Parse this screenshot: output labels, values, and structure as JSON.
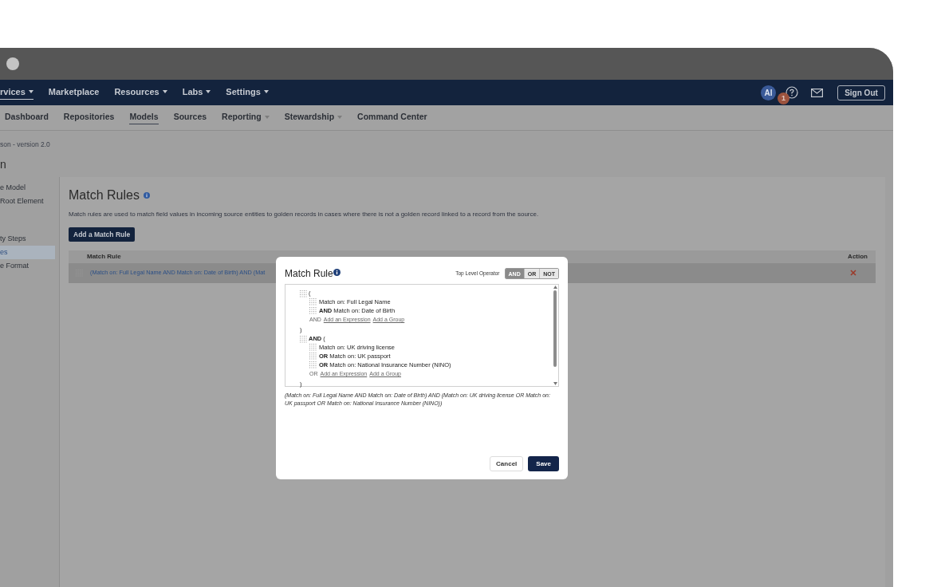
{
  "top_nav": {
    "items": [
      {
        "label": "rvices",
        "caret": true,
        "selected": true
      },
      {
        "label": "Marketplace",
        "caret": false,
        "selected": false
      },
      {
        "label": "Resources",
        "caret": true,
        "selected": false
      },
      {
        "label": "Labs",
        "caret": true,
        "selected": false
      },
      {
        "label": "Settings",
        "caret": true,
        "selected": false
      }
    ],
    "avatar": "AI",
    "help_badge": "1",
    "sign_out": "Sign Out"
  },
  "sub_nav": [
    {
      "label": "Dashboard",
      "caret": false,
      "selected": false
    },
    {
      "label": "Repositories",
      "caret": false,
      "selected": false
    },
    {
      "label": "Models",
      "caret": false,
      "selected": true
    },
    {
      "label": "Sources",
      "caret": false,
      "selected": false
    },
    {
      "label": "Reporting",
      "caret": true,
      "selected": false
    },
    {
      "label": "Stewardship",
      "caret": true,
      "selected": false
    },
    {
      "label": "Command Center",
      "caret": false,
      "selected": false
    }
  ],
  "breadcrumb": "son - version 2.0",
  "page_title": "n",
  "sidebar": {
    "groups": [
      [
        {
          "label": "e Model",
          "selected": false
        },
        {
          "label": "Root Element",
          "selected": false
        }
      ],
      [
        {
          "label": "ty Steps",
          "selected": false
        },
        {
          "label": "es",
          "selected": true
        },
        {
          "label": "e Format",
          "selected": false
        }
      ]
    ]
  },
  "main": {
    "title": "Match Rules",
    "description": "Match rules are used to match field values in incoming source entities to golden records in cases where there is not a golden record linked to a record from the source.",
    "add_button": "Add a Match Rule",
    "table": {
      "columns": [
        "Match Rule",
        "Action"
      ],
      "rows": [
        {
          "match_rule": "(Match on: Full Legal Name AND Match on: Date of Birth) AND (Mat",
          "selected": true
        }
      ]
    }
  },
  "dialog": {
    "title": "Match Rule",
    "operator_label": "Top Level Operator",
    "operators": [
      {
        "label": "AND",
        "selected": true
      },
      {
        "label": "OR",
        "selected": false
      },
      {
        "label": "NOT",
        "selected": false
      }
    ],
    "groups": [
      {
        "open": "(",
        "close": ")",
        "expressions": [
          {
            "text": "Match on: Full Legal Name"
          },
          {
            "operator": "AND",
            "text": "Match on: Date of Birth"
          }
        ],
        "add_operator": "AND",
        "add_links": [
          "Add an Expression",
          "Add a Group"
        ]
      },
      {
        "operator": "AND",
        "open": "(",
        "close": ")",
        "expressions": [
          {
            "text": "Match on: UK driving license"
          },
          {
            "operator": "OR",
            "text": "Match on: UK passport"
          },
          {
            "operator": "OR",
            "text": "Match on: National Insurance Number (NINO)"
          }
        ],
        "add_operator": "OR",
        "add_links": [
          "Add an Expression",
          "Add a Group"
        ]
      }
    ],
    "summary": "(Match on: Full Legal Name AND Match on: Date of Birth) AND (Match on: UK driving license OR Match on: UK passport OR Match on: National Insurance Number (NINO))",
    "buttons": [
      {
        "label": "Cancel",
        "kind": "secondary"
      },
      {
        "label": "Save",
        "kind": "primary"
      }
    ]
  }
}
